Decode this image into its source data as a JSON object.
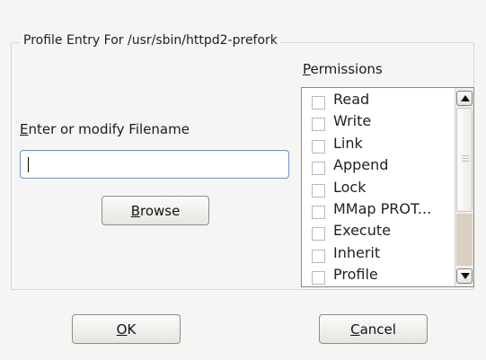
{
  "group": {
    "title": "Profile Entry For /usr/sbin/httpd2-prefork"
  },
  "filename": {
    "label_mnemonic": "E",
    "label_rest": "nter or modify Filename",
    "value": ""
  },
  "browse_button": {
    "mnemonic": "B",
    "rest": "rowse"
  },
  "permissions": {
    "label_mnemonic": "P",
    "label_rest": "ermissions",
    "items": [
      {
        "label": "Read",
        "checked": false
      },
      {
        "label": "Write",
        "checked": false
      },
      {
        "label": "Link",
        "checked": false
      },
      {
        "label": "Append",
        "checked": false
      },
      {
        "label": "Lock",
        "checked": false
      },
      {
        "label": "MMap PROT...",
        "checked": false
      },
      {
        "label": "Execute",
        "checked": false
      },
      {
        "label": "Inherit",
        "checked": false
      },
      {
        "label": "Profile",
        "checked": false
      }
    ]
  },
  "ok_button": {
    "mnemonic": "O",
    "rest": "K"
  },
  "cancel_button": {
    "mnemonic": "C",
    "rest": "ancel"
  },
  "colors": {
    "focus_border": "#6f93c6",
    "trough": "#d9d0c2"
  }
}
